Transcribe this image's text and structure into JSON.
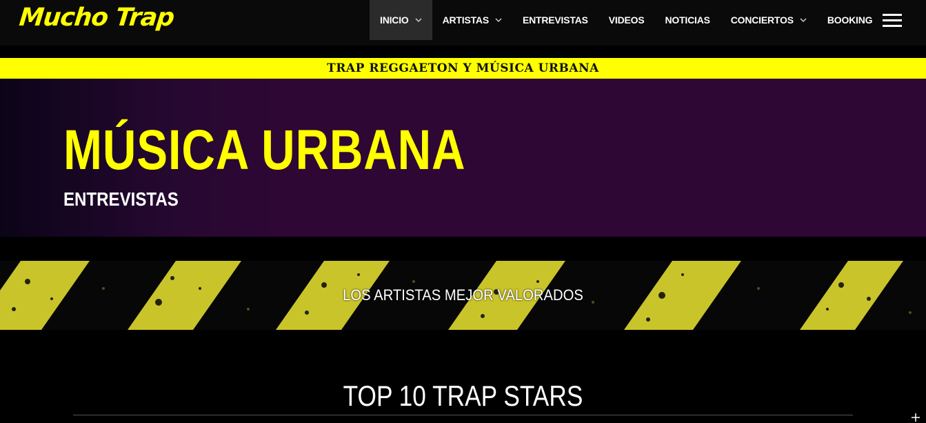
{
  "header": {
    "logo": "Mucho Trap",
    "nav": [
      {
        "label": "INICIO",
        "dropdown": true,
        "active": true
      },
      {
        "label": "ARTISTAS",
        "dropdown": true
      },
      {
        "label": "ENTREVISTAS",
        "dropdown": false
      },
      {
        "label": "VIDEOS",
        "dropdown": false
      },
      {
        "label": "NOTICIAS",
        "dropdown": false
      },
      {
        "label": "CONCIERTOS",
        "dropdown": true
      },
      {
        "label": "BOOKING",
        "dropdown": false
      }
    ],
    "menu_icon": "hamburger-icon"
  },
  "tagline": "TRAP REGGAETON Y MÚSICA URBANA",
  "hero": {
    "title": "MÚSICA URBANA",
    "subtitle": "ENTREVISTAS"
  },
  "band": {
    "text": "LOS ARTISTAS MEJOR VALORADOS"
  },
  "section": {
    "title": "TOP 10 TRAP STARS"
  },
  "colors": {
    "accent": "#ffff00",
    "hero_bg": "#2e0735",
    "stripe": "#c9c42a",
    "header_bg": "#0a0a0a"
  }
}
